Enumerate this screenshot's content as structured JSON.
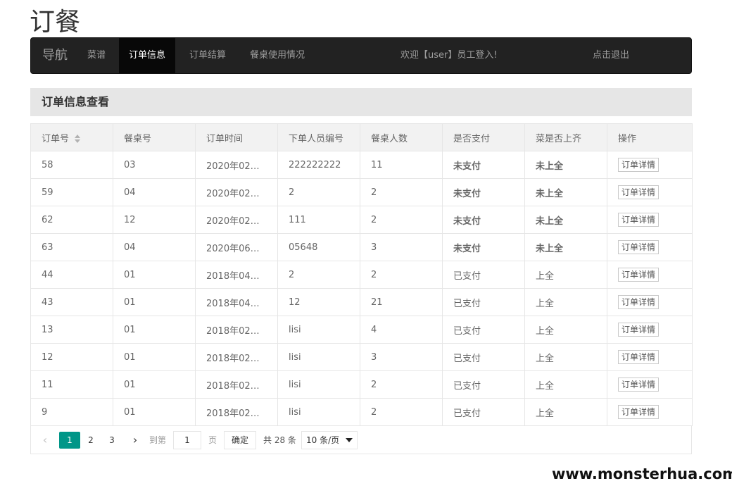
{
  "app": {
    "title": "订餐"
  },
  "nav": {
    "brand": "导航",
    "items": [
      {
        "label": "菜谱",
        "active": false
      },
      {
        "label": "订单信息",
        "active": true
      },
      {
        "label": "订单结算",
        "active": false
      },
      {
        "label": "餐桌使用情况",
        "active": false
      }
    ],
    "welcome": "欢迎【user】员工登入!",
    "logout": "点击退出"
  },
  "panel": {
    "title": "订单信息查看"
  },
  "table": {
    "headers": [
      "订单号",
      "餐桌号",
      "订单时间",
      "下单人员编号",
      "餐桌人数",
      "是否支付",
      "菜是否上齐",
      "操作"
    ],
    "detail_label": "订单详情",
    "rows": [
      {
        "order_no": "58",
        "table_no": "03",
        "time": "2020年02…",
        "staff_no": "222222222",
        "people": "11",
        "paid": "未支付",
        "served": "未上全"
      },
      {
        "order_no": "59",
        "table_no": "04",
        "time": "2020年02…",
        "staff_no": "2",
        "people": "2",
        "paid": "未支付",
        "served": "未上全"
      },
      {
        "order_no": "62",
        "table_no": "12",
        "time": "2020年02…",
        "staff_no": "111",
        "people": "2",
        "paid": "未支付",
        "served": "未上全"
      },
      {
        "order_no": "63",
        "table_no": "04",
        "time": "2020年06…",
        "staff_no": "05648",
        "people": "3",
        "paid": "未支付",
        "served": "未上全"
      },
      {
        "order_no": "44",
        "table_no": "01",
        "time": "2018年04…",
        "staff_no": "2",
        "people": "2",
        "paid": "已支付",
        "served": "上全"
      },
      {
        "order_no": "43",
        "table_no": "01",
        "time": "2018年04…",
        "staff_no": "12",
        "people": "21",
        "paid": "已支付",
        "served": "上全"
      },
      {
        "order_no": "13",
        "table_no": "01",
        "time": "2018年02…",
        "staff_no": "lisi",
        "people": "4",
        "paid": "已支付",
        "served": "上全"
      },
      {
        "order_no": "12",
        "table_no": "01",
        "time": "2018年02…",
        "staff_no": "lisi",
        "people": "3",
        "paid": "已支付",
        "served": "上全"
      },
      {
        "order_no": "11",
        "table_no": "01",
        "time": "2018年02…",
        "staff_no": "lisi",
        "people": "2",
        "paid": "已支付",
        "served": "上全"
      },
      {
        "order_no": "9",
        "table_no": "01",
        "time": "2018年02…",
        "staff_no": "lisi",
        "people": "2",
        "paid": "已支付",
        "served": "上全"
      }
    ]
  },
  "pager": {
    "pages": [
      "1",
      "2",
      "3"
    ],
    "current": "1",
    "goto_label": "到第",
    "goto_value": "1",
    "page_unit": "页",
    "confirm": "确定",
    "total": "共 28 条",
    "page_size": "10 条/页"
  },
  "watermark": "www.monsterhua.com",
  "colors": {
    "unpaid": "#a31515",
    "accent": "#009688",
    "navbar": "#222222"
  }
}
